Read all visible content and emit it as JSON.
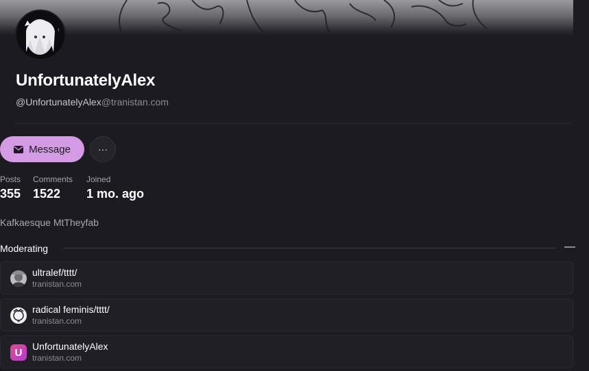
{
  "profile": {
    "display_name": "UnfortunatelyAlex",
    "handle_user": "@UnfortunatelyAlex",
    "handle_instance": "@tranistan.com",
    "bio": "Kafkaesque MtTheyfab"
  },
  "actions": {
    "message_label": "Message",
    "more_label": "···"
  },
  "stats": [
    {
      "label": "Posts",
      "value": "355"
    },
    {
      "label": "Comments",
      "value": "1522"
    },
    {
      "label": "Joined",
      "value": "1 mo. ago"
    }
  ],
  "moderating": {
    "title": "Moderating",
    "collapse_symbol": "—",
    "communities": [
      {
        "name": "ultralef/tttt/",
        "instance": "tranistan.com",
        "icon": "grayscale-photo-icon"
      },
      {
        "name": "radical feminis/tttt/",
        "instance": "tranistan.com",
        "icon": "sketch-avatar-icon"
      },
      {
        "name": "UnfortunatelyAlex",
        "instance": "tranistan.com",
        "icon": "letter-u-icon",
        "icon_letter": "U"
      }
    ]
  },
  "colors": {
    "accent": "#d59ae4",
    "background": "#1d1b22",
    "card": "#211f26",
    "muted_text": "#8c8a92"
  }
}
